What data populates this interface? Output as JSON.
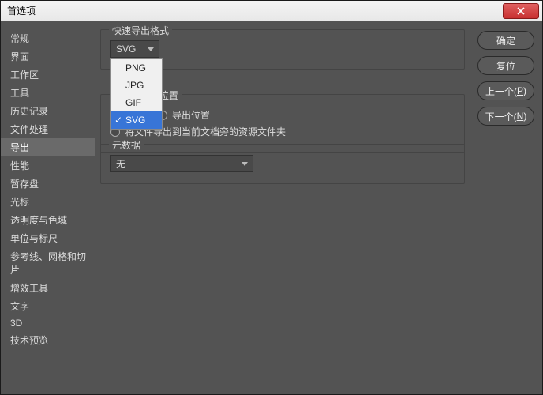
{
  "window": {
    "title": "首选项"
  },
  "sidebar": {
    "items": [
      {
        "label": "常规"
      },
      {
        "label": "界面"
      },
      {
        "label": "工作区"
      },
      {
        "label": "工具"
      },
      {
        "label": "历史记录"
      },
      {
        "label": "文件处理"
      },
      {
        "label": "导出",
        "selected": true
      },
      {
        "label": "性能"
      },
      {
        "label": "暂存盘"
      },
      {
        "label": "光标"
      },
      {
        "label": "透明度与色域"
      },
      {
        "label": "单位与标尺"
      },
      {
        "label": "参考线、网格和切片"
      },
      {
        "label": "增效工具"
      },
      {
        "label": "文字"
      },
      {
        "label": "3D"
      },
      {
        "label": "技术预览"
      }
    ]
  },
  "groups": {
    "quick_export": {
      "title": "快速导出格式",
      "selected": "SVG",
      "options": [
        "PNG",
        "JPG",
        "GIF",
        "SVG"
      ]
    },
    "location": {
      "title": "位置",
      "opt1": "导出位置",
      "opt2": "将文件导出到当前文档旁的资源文件夹"
    },
    "metadata": {
      "title": "元数据",
      "selected": "无"
    }
  },
  "buttons": {
    "ok": "确定",
    "reset": "复位",
    "prev_a": "上一个(",
    "prev_b": "P",
    "prev_c": ")",
    "next_a": "下一个(",
    "next_b": "N",
    "next_c": ")"
  }
}
